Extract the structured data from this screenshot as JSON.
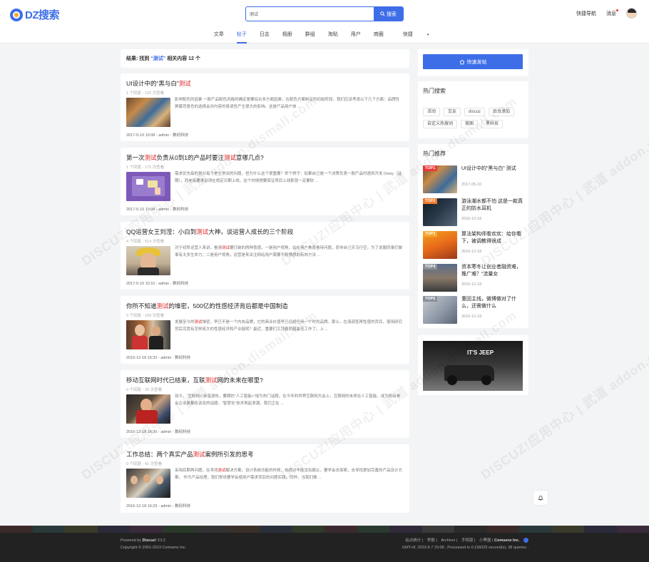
{
  "header": {
    "logo_text": "DZ搜索",
    "search_value": "测试",
    "search_button": "搜索",
    "quick_nav": "快捷导航",
    "messages": "消息"
  },
  "nav": {
    "tabs": [
      "文章",
      "帖子",
      "日志",
      "相册",
      "群组",
      "淘贴",
      "用户",
      "商圈",
      "快捷"
    ],
    "active": "帖子"
  },
  "result": {
    "prefix": "结果: 找到",
    "query": "“测试”",
    "middle": "相关内容",
    "count": "12",
    "suffix": "个"
  },
  "posts": [
    {
      "title_parts": [
        "UI设计中的“黑与白”",
        "测试",
        ""
      ],
      "meta": "1 个回复 - 120 次查看",
      "excerpt": [
        "影响配色的因素 一款产品配色风格的确定是要综合多方面因素，在配色方案制定的初始阶段，我们应该考虑以下几个方面：品牌性 屏幕背景色的选择会对内容的易读性产生很大的影响。这是产品用户体 ..."
      ],
      "footer": "2017-5-10 10:08 - admin - 数码科技"
    },
    {
      "title_parts": [
        "第一次",
        "测试",
        "负责从0到1的产品时要注",
        "测试",
        "意哪几点?"
      ],
      "meta": "1 个回复 - 175 次查看",
      "excerpt": [
        "需求优先级的划分每个老生常谈的问题，但为什么这个很重要？举个例子：如果自己是一个决策负责一款产品时遇到开发 Delay（延期），而老板要求必须在规定日期上线，这个时候想要保证项目上线那就一定要砍 ..."
      ],
      "footer": "2017-5-10 10:09 - admin - 数码科技"
    },
    {
      "title_parts": [
        "QQ运营女王刘滢：小白到",
        "测试",
        "大神，谈运营人成长的三个阶段"
      ],
      "meta": "4 个回复 - 514 次查看",
      "excerpt": [
        "对于初阶运营人来讲，看清",
        "测试",
        "要打破的两种喜感。一是用户视角，站在用户角度看待问题，而非自己天马行空。为了说服同事们做事有太多生命力；二是用户视角，运营是来关注网站用户需要不断想想的有效方法 ..."
      ],
      "footer": "2017-5-10 10:10 - admin - 数码科技"
    },
    {
      "title_parts": [
        "你所不知道",
        "测试",
        "的堆密，500亿的性感经济背后都是中国制造"
      ],
      "meta": "0 个回复 - 109 次查看",
      "excerpt": [
        "发展至今的",
        "测试",
        "堆密，早已不是一个内衣品牌，它的商业价值早已远超任何一个时尚品牌。那么，在海调查再性感的背后，使用研究背后究竟有怎样庞大的性感经济和产业链呢？最近，重要们又顶着两届最佳工作了。上 ..."
      ],
      "footer": "2016-12-18 16:32 - admin - 数码科技"
    },
    {
      "title_parts": [
        "移动互联网时代已结束，互联",
        "测试",
        "网的未来在哪里?"
      ],
      "meta": "0 个回复 - 39 次查看",
      "excerpt": [
        "如今，“互联网+”余温退热，要期的“人工智能+”成为热门话题。在今年的世界互联网大会上，互联网的未来在人工智能，成为所有参会企业家都在谈及的话题。“智慧化”技术再起浪潮，我们正在 ..."
      ],
      "footer": "2016-12-18 16:30 - admin - 数码科技"
    },
    {
      "title_parts": [
        "工作总结：两个真实产品",
        "测试",
        "案例所引发的思考"
      ],
      "meta": "0 个回复 - 41 次查看",
      "excerpt": [
        "采用后期再问题，在寻找",
        "测试",
        "解决方案，设计系统功能的时候，也绝对不能没有戳止，要学会去探索，去寻找更加完善的产品设计方案。 作为产品经理，我们常说要学会使用户需求背后的问题实践，同样，当我们做 ..."
      ],
      "footer": "2016-12-18 16:29 - admin - 数码科技"
    }
  ],
  "sidebar": {
    "post_button": "快速发帖",
    "hot_search_title": "热门搜索",
    "hot_tags": [
      "活动",
      "交友",
      "discuz",
      "后台添加",
      "自定义热搜词",
      "美图",
      "黑科技"
    ],
    "recommend_title": "热门推荐",
    "recommend": [
      {
        "rank": "TOP1",
        "title": "UI设计中的“黑与白” 测试",
        "date": "2017-05-10"
      },
      {
        "rank": "TOP2",
        "title": "游泳潮水都不怕 这是一款真正的防水耳机",
        "date": "2016-12-18"
      },
      {
        "rank": "TOP3",
        "title": "算法架构师看欢欢：给你看下，被调教得很成",
        "date": "2016-12-18"
      },
      {
        "rank": "TOP4",
        "title": "资本寒冬让创业者融资难，推广难？“流量女",
        "date": "2016-12-18"
      },
      {
        "rank": "TOP5",
        "title": "重回主线，微博做对了什么，还需做什么",
        "date": "2016-12-18"
      }
    ],
    "ad_text": "IT'S JEEP"
  },
  "footer": {
    "powered_prefix": "Powered by",
    "powered_name": "Discuz!",
    "version": "X3.2",
    "copyright": "Copyright © 2001-2013 Comsenz Inc.",
    "links": [
      "站点统计",
      "举报",
      "Archiver",
      "手机版",
      "小黑屋",
      "Comsenz Inc."
    ],
    "stats": "GMT+8, 2023-9-7 15:08 , Processed in 0.156025 second(s), 38 queries ."
  },
  "watermark": "DISCUZ!应用中心 | 武道 addon.dismall.com",
  "colors": {
    "accent": "#3d6ee8",
    "highlight": "#e02020",
    "rank1": "#e83a3a",
    "rank2": "#f07a2a",
    "rank3": "#f2a62b",
    "rank_other": "#8a8f98"
  }
}
